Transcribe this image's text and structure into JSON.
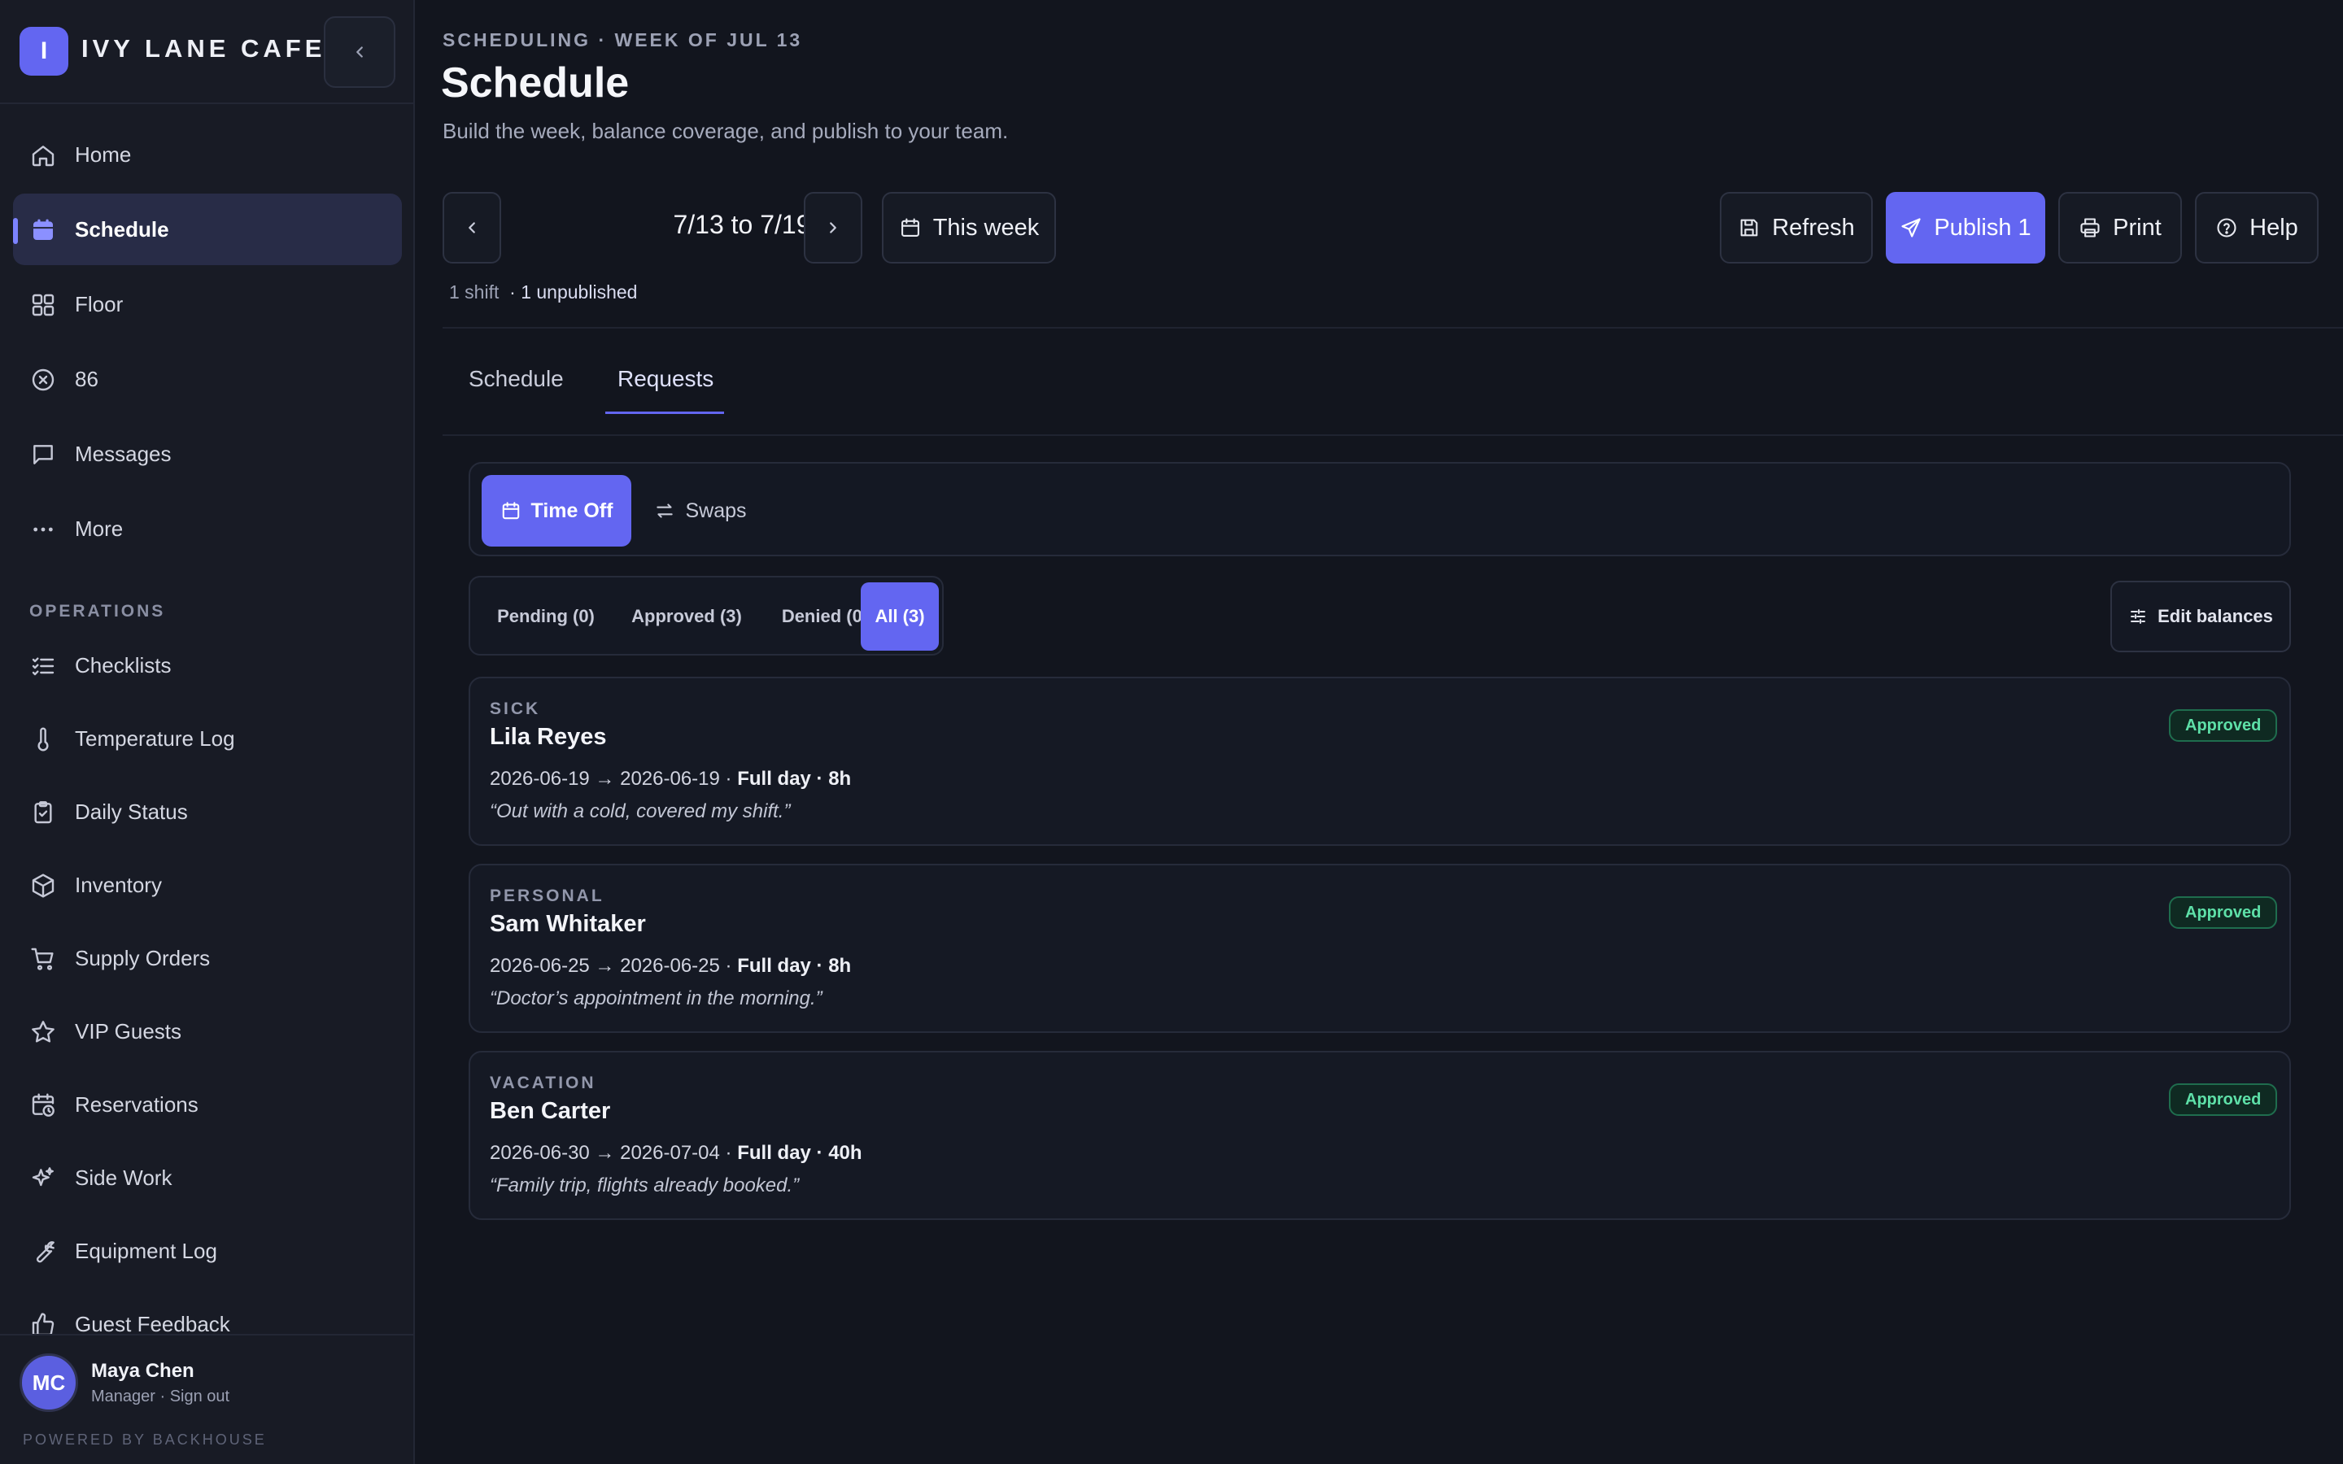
{
  "brand": {
    "logo_letter": "I",
    "name": "IVY LANE CAFE"
  },
  "sidebar": {
    "primary": [
      {
        "label": "Home",
        "icon": "home-icon"
      },
      {
        "label": "Schedule",
        "icon": "calendar-icon",
        "active": true
      },
      {
        "label": "Floor",
        "icon": "grid-icon"
      },
      {
        "label": "86",
        "icon": "x-circle-icon"
      },
      {
        "label": "Messages",
        "icon": "message-icon"
      },
      {
        "label": "More",
        "icon": "more-icon"
      }
    ],
    "section_label": "OPERATIONS",
    "operations": [
      {
        "label": "Checklists",
        "icon": "checklist-icon"
      },
      {
        "label": "Temperature Log",
        "icon": "thermometer-icon"
      },
      {
        "label": "Daily Status",
        "icon": "clipboard-icon"
      },
      {
        "label": "Inventory",
        "icon": "box-icon"
      },
      {
        "label": "Supply Orders",
        "icon": "cart-icon"
      },
      {
        "label": "VIP Guests",
        "icon": "star-icon"
      },
      {
        "label": "Reservations",
        "icon": "calendar-clock-icon"
      },
      {
        "label": "Side Work",
        "icon": "sparkles-icon"
      },
      {
        "label": "Equipment Log",
        "icon": "wrench-icon"
      },
      {
        "label": "Guest Feedback",
        "icon": "thumbs-up-icon"
      }
    ],
    "user": {
      "initials": "MC",
      "name": "Maya Chen",
      "role": "Manager · Sign out"
    },
    "powered_by": "POWERED BY BACKHOUSE"
  },
  "header": {
    "breadcrumb": "SCHEDULING · WEEK OF JUL 13",
    "title": "Schedule",
    "subtitle": "Build the week, balance coverage, and publish to your team."
  },
  "toolbar": {
    "range": "7/13 to 7/19",
    "this_week": "This week",
    "refresh": "Refresh",
    "publish": "Publish 1",
    "print": "Print",
    "help": "Help"
  },
  "meta": {
    "shifts": "1 shift",
    "unpublished": "· 1 unpublished"
  },
  "tabs": [
    {
      "label": "Schedule",
      "active": false
    },
    {
      "label": "Requests",
      "active": true
    }
  ],
  "request_types": {
    "time_off": "Time Off",
    "swaps": "Swaps"
  },
  "filters": [
    {
      "label": "Pending (0)",
      "active": false
    },
    {
      "label": "Approved (3)",
      "active": false
    },
    {
      "label": "Denied (0)",
      "active": false
    },
    {
      "label": "All (3)",
      "active": true
    }
  ],
  "edit_balances": "Edit balances",
  "requests": [
    {
      "type": "SICK",
      "name": "Lila Reyes",
      "dates": "2026-06-19 → 2026-06-19 · ",
      "duration": "Full day · 8h",
      "note": "“Out with a cold, covered my shift.”",
      "status": "Approved"
    },
    {
      "type": "PERSONAL",
      "name": "Sam Whitaker",
      "dates": "2026-06-25 → 2026-06-25 · ",
      "duration": "Full day · 8h",
      "note": "“Doctor’s appointment in the morning.”",
      "status": "Approved"
    },
    {
      "type": "VACATION",
      "name": "Ben Carter",
      "dates": "2026-06-30 → 2026-07-04 · ",
      "duration": "Full day · 40h",
      "note": "“Family trip, flights already booked.”",
      "status": "Approved"
    }
  ],
  "colors": {
    "accent": "#6366f1",
    "approved": "#5ee0a8",
    "background": "#12151e",
    "sidebar": "#181b25"
  }
}
